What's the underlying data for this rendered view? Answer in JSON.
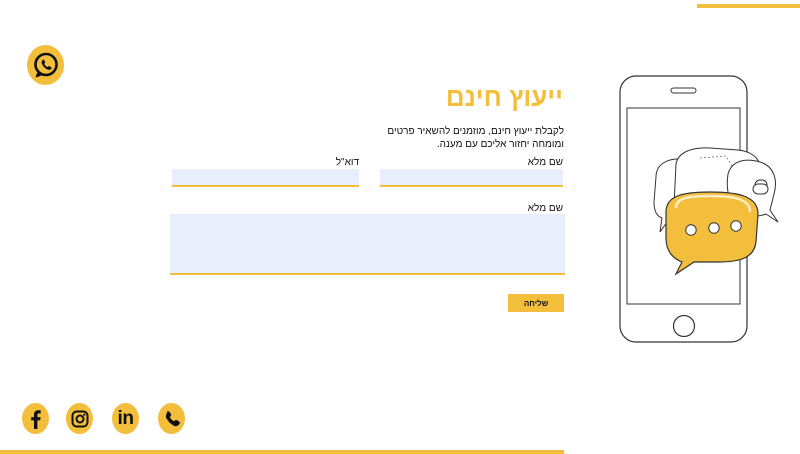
{
  "header": {
    "title": "ייעוץ חינם"
  },
  "intro": {
    "text": "לקבלת ייעוץ חינם, מוזמנים להשאיר פרטים ומומחה יחזור אליכם עם מענה."
  },
  "form": {
    "name_label": "שם מלא",
    "email_label": "דוא\"ל",
    "message_label": "שם מלא",
    "name_value": "",
    "email_value": "",
    "message_value": "",
    "submit_label": "שליחה"
  },
  "social": {
    "linkedin_text": "in",
    "icons": [
      "whatsapp-icon",
      "facebook-icon",
      "instagram-icon",
      "linkedin-icon",
      "phone-icon"
    ]
  },
  "colors": {
    "accent": "#f2be3c",
    "input_bg": "#e8eefb",
    "text": "#111111"
  }
}
